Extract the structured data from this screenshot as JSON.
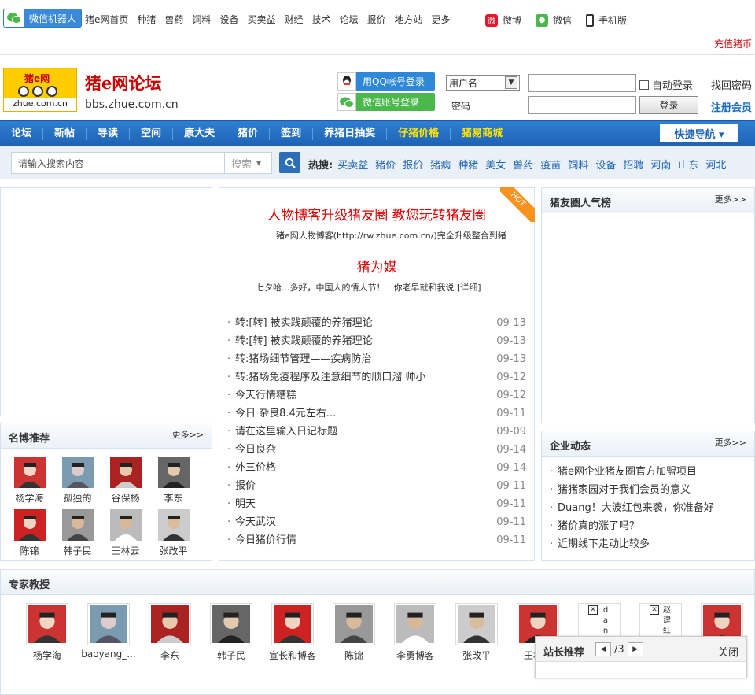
{
  "topbar": {
    "wx_robot": "微信机器人",
    "nav": [
      "猪e网首页",
      "种猪",
      "兽药",
      "饲料",
      "设备",
      "买卖益",
      "财经",
      "技术",
      "论坛",
      "报价",
      "地方站",
      "更多"
    ],
    "links": [
      {
        "label": "微博",
        "icon": "weibo-icon"
      },
      {
        "label": "微信",
        "icon": "wechat-icon"
      },
      {
        "label": "手机版",
        "icon": "mobile-icon"
      }
    ],
    "recharge": "充值猪币"
  },
  "header": {
    "logo_top": "猪e网",
    "logo_bottom": "zhue.com.cn",
    "brand": "猪e网论坛",
    "url": "bbs.zhue.com.cn",
    "qq_login": "用QQ帐号登录",
    "wx_login": "微信账号登录",
    "username_select": "用户名",
    "password_label": "密码",
    "auto_login": "自动登录",
    "login_btn": "登录",
    "find_pwd": "找回密码",
    "register": "注册会员"
  },
  "mainnav": {
    "items": [
      {
        "label": "论坛",
        "highlight": false
      },
      {
        "label": "新帖",
        "highlight": false
      },
      {
        "label": "导读",
        "highlight": false
      },
      {
        "label": "空间",
        "highlight": false
      },
      {
        "label": "康大夫",
        "highlight": false
      },
      {
        "label": "猪价",
        "highlight": false
      },
      {
        "label": "签到",
        "highlight": false
      },
      {
        "label": "养猪日抽奖",
        "highlight": false
      },
      {
        "label": "仔猪价格",
        "highlight": true
      },
      {
        "label": "猪易商城",
        "highlight": true
      }
    ],
    "quick": "快捷导航 ▾"
  },
  "search": {
    "placeholder": "请输入搜索内容",
    "select": "搜索",
    "hot_label": "热搜:",
    "hot": [
      "买卖益",
      "猪价",
      "报价",
      "猪病",
      "种猪",
      "美女",
      "兽药",
      "疫苗",
      "饲料",
      "设备",
      "招聘",
      "河南",
      "山东",
      "河北"
    ]
  },
  "mingbo": {
    "title": "名博推荐",
    "more": "更多>>",
    "people": [
      "杨学海",
      "孤独的",
      "谷保杨",
      "李东",
      "陈锦",
      "韩子民",
      "王林云",
      "张改平"
    ]
  },
  "featured": {
    "badge": "HOT",
    "title": "人物博客升级猪友圈 教您玩转猪友圈",
    "desc": "猪e网人物博客(http://rw.zhue.com.cn/)完全升级整合到猪",
    "title2": "猪为媒",
    "desc2": "七夕哈...多好，中国人的情人节！　你老早就和我说 [详细]",
    "articles": [
      {
        "title": "转:[转] 被实践颠覆的养猪理论",
        "date": "09-13"
      },
      {
        "title": "转:[转] 被实践颠覆的养猪理论",
        "date": "09-13"
      },
      {
        "title": "转:猪场细节管理——疾病防治",
        "date": "09-13"
      },
      {
        "title": "转:猪场免疫程序及注意细节的顺口溜 帅小",
        "date": "09-12"
      },
      {
        "title": "今天行情糟糕",
        "date": "09-12"
      },
      {
        "title": "今日 杂良8.4元左右...",
        "date": "09-11"
      },
      {
        "title": "请在这里输入日记标题",
        "date": "09-09"
      },
      {
        "title": "今日良杂",
        "date": "09-14"
      },
      {
        "title": "外三价格",
        "date": "09-14"
      },
      {
        "title": "报价",
        "date": "09-11"
      },
      {
        "title": "明天",
        "date": "09-11"
      },
      {
        "title": "今天武汉",
        "date": "09-11"
      },
      {
        "title": "今日猪价行情",
        "date": "09-11"
      }
    ]
  },
  "rank": {
    "title": "猪友圈人气榜",
    "more": "更多>>"
  },
  "company": {
    "title": "企业动态",
    "more": "更多>>",
    "items": [
      "猪e网企业猪友圈官方加盟项目",
      "猪猪家园对于我们会员的意义",
      "Duang！大波红包来袭，你准备好",
      "猪价真的涨了吗？",
      "近期线下走动比较多"
    ]
  },
  "experts": {
    "title": "专家教授",
    "people": [
      "杨学海",
      "baoyang_...",
      "李东",
      "韩子民",
      "宣长和博客",
      "陈锦",
      "李勇博客",
      "张改平",
      "王林云"
    ],
    "broken1": "da nd",
    "broken2": "赵建红"
  },
  "popup": {
    "title": "站长推荐",
    "page": "/3",
    "close": "关闭"
  }
}
